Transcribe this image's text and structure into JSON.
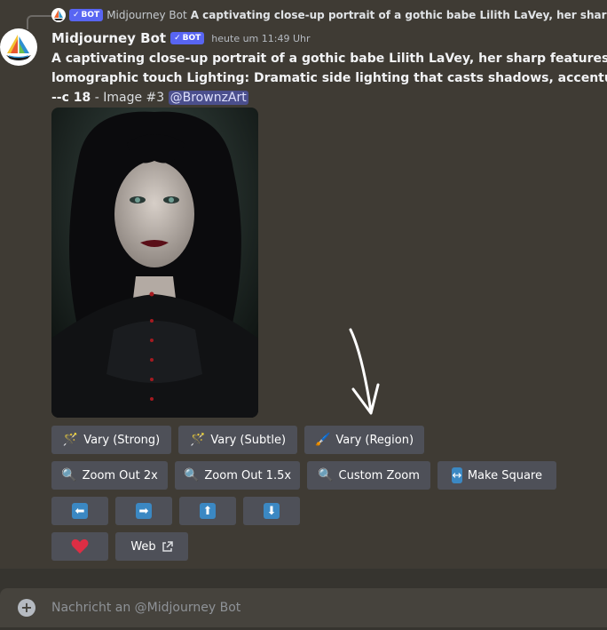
{
  "reply": {
    "name": "Midjourney Bot",
    "badge": "BOT",
    "text": "A captivating close-up portrait of a gothic babe Lilith LaVey, her sharp featu"
  },
  "message": {
    "username": "Midjourney Bot",
    "badge": "BOT",
    "timestamp": "heute um 11:49 Uhr",
    "line1": "A captivating close-up portrait of a gothic babe Lilith LaVey, her sharp features and inter",
    "line2": "lomographic touch Lighting: Dramatic side lighting that casts shadows, accentuating the",
    "line3_bold": "--c 18",
    "line3_rest": " - Image #3 ",
    "mention": "@BrownzArt"
  },
  "buttons": {
    "row1": [
      {
        "label": "Vary (Strong)",
        "icon": "sparkles-icon"
      },
      {
        "label": "Vary (Subtle)",
        "icon": "sparkles-icon"
      },
      {
        "label": "Vary (Region)",
        "icon": "paintbrush-icon"
      }
    ],
    "row2": [
      {
        "label": "Zoom Out 2x",
        "icon": "magnifier-icon"
      },
      {
        "label": "Zoom Out 1.5x",
        "icon": "magnifier-icon"
      },
      {
        "label": "Custom Zoom",
        "icon": "magnifier-icon"
      },
      {
        "label": "Make Square",
        "icon": "left-right-arrow-icon"
      }
    ],
    "arrows": [
      "arrow-left-icon",
      "arrow-right-icon",
      "arrow-up-icon",
      "arrow-down-icon"
    ],
    "web_label": "Web"
  },
  "composer": {
    "placeholder": "Nachricht an @Midjourney Bot"
  },
  "colors": {
    "background": "#3f3b34",
    "button": "#4e5058",
    "badge": "#5865f2",
    "mention": "#4b4f8d",
    "arrow_box": "#3b88c3",
    "heart": "#dd2e44"
  }
}
